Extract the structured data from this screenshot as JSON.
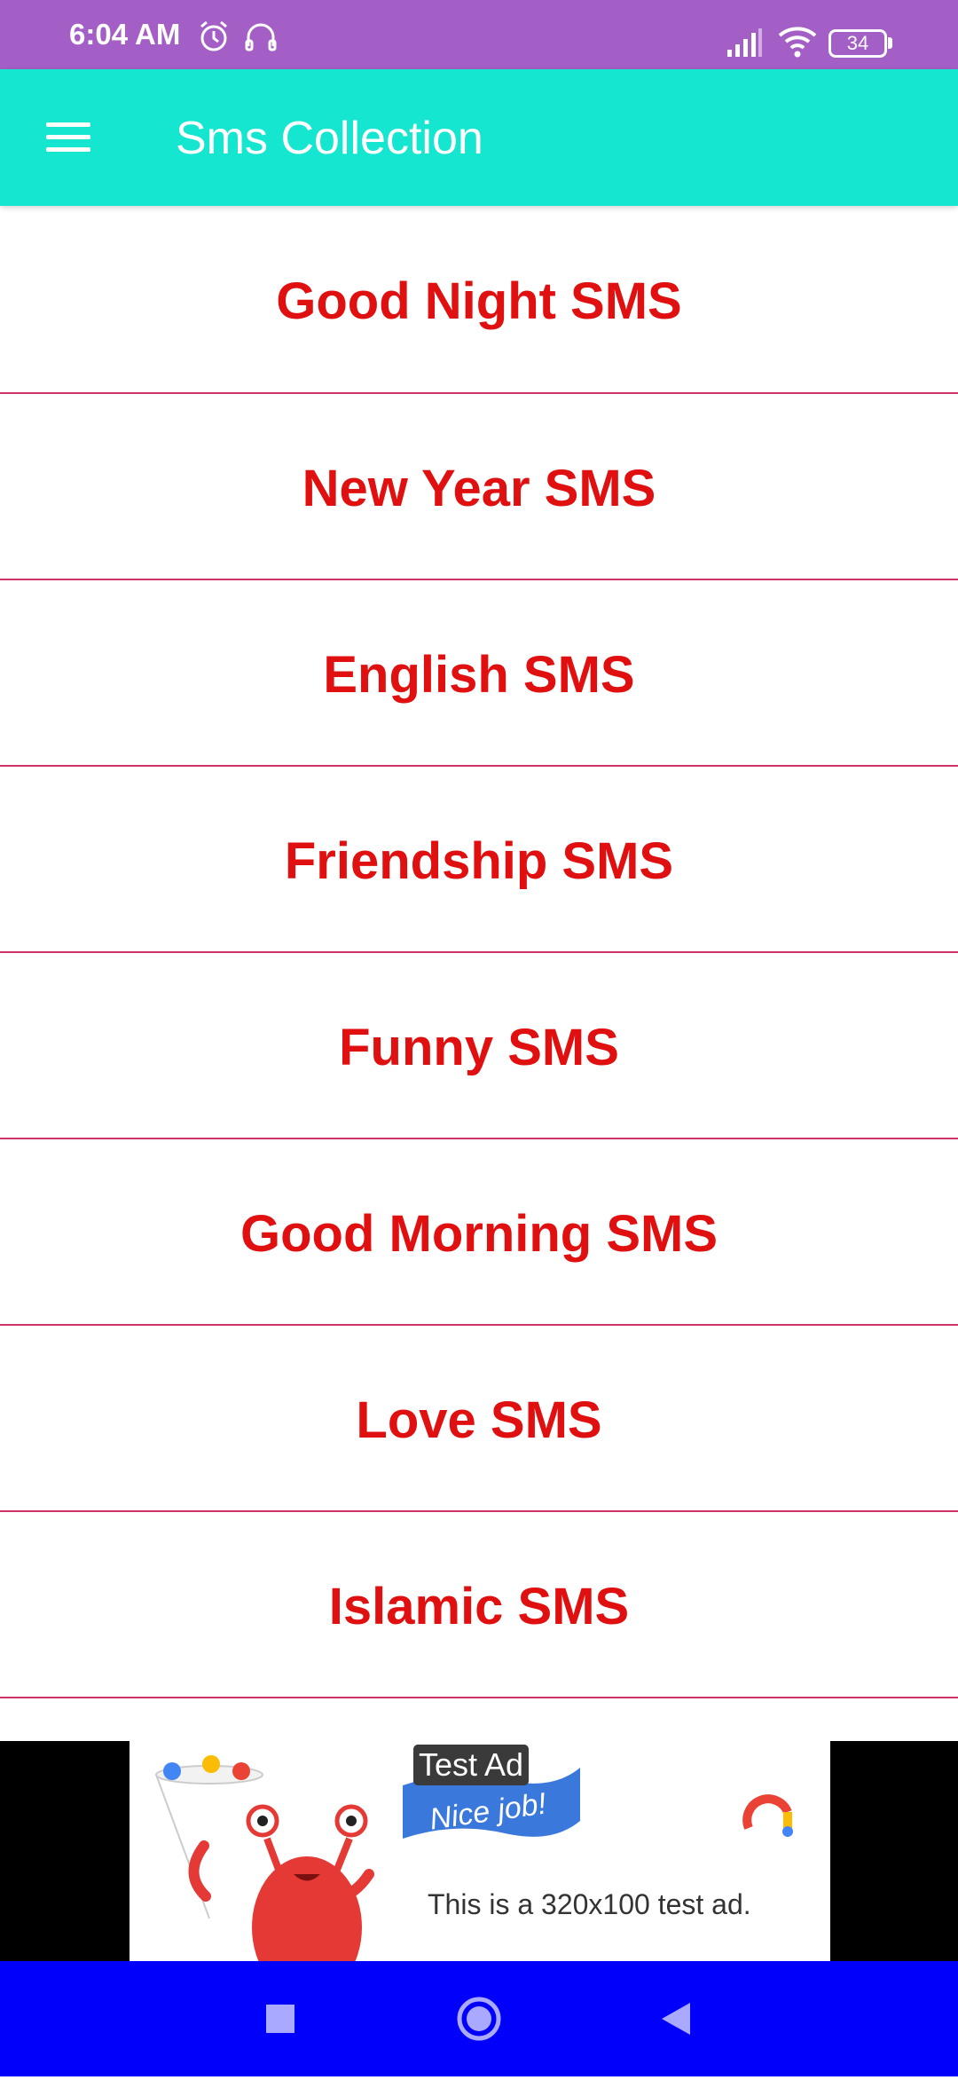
{
  "status_bar": {
    "time": "6:04 AM",
    "icons": [
      "alarm-icon",
      "headset-icon",
      "signal-icon",
      "wifi-icon"
    ],
    "battery": "34"
  },
  "app_bar": {
    "title": "Sms Collection",
    "menu_icon": "hamburger-menu-icon",
    "background": "#14e6cf"
  },
  "categories": [
    {
      "label": "Good Night SMS"
    },
    {
      "label": "New Year SMS"
    },
    {
      "label": "English SMS"
    },
    {
      "label": "Friendship SMS"
    },
    {
      "label": "Funny SMS"
    },
    {
      "label": "Good Morning SMS"
    },
    {
      "label": "Love SMS"
    },
    {
      "label": "Islamic SMS"
    }
  ],
  "ad": {
    "tag": "Test Ad",
    "flag_text": "Nice job!",
    "text": "This is a 320x100 test ad."
  },
  "nav_bar": {
    "buttons": [
      "recents-button",
      "home-button",
      "back-button"
    ],
    "background": "#0000fb"
  },
  "colors": {
    "status_bar": "#a45fc6",
    "label": "#e01010",
    "divider": "#cc3466"
  }
}
